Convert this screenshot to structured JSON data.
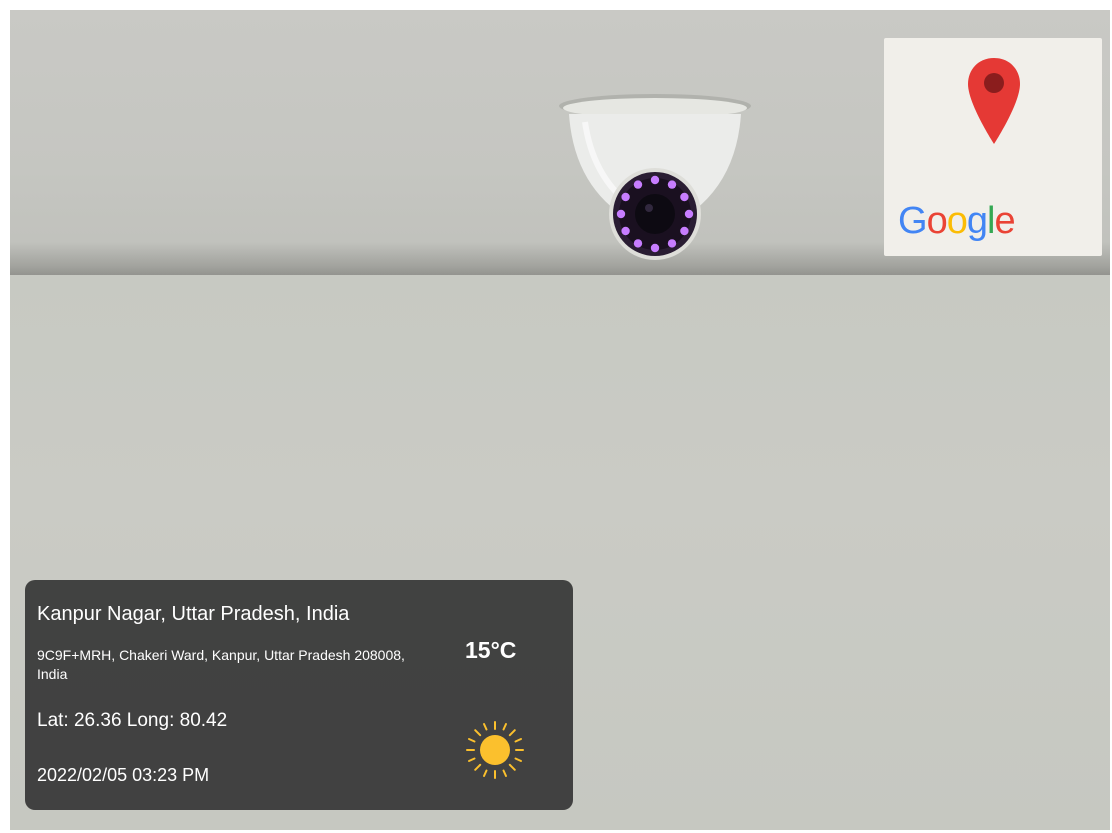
{
  "map_card": {
    "logo_text": "Google",
    "logo_letters": [
      {
        "char": "G",
        "color": "#4285F4"
      },
      {
        "char": "o",
        "color": "#EA4335"
      },
      {
        "char": "o",
        "color": "#FBBC05"
      },
      {
        "char": "g",
        "color": "#4285F4"
      },
      {
        "char": "l",
        "color": "#34A853"
      },
      {
        "char": "e",
        "color": "#EA4335"
      }
    ],
    "pin_icon": "map-pin-icon",
    "pin_color": "#E53935"
  },
  "info_panel": {
    "location_title": "Kanpur Nagar, Uttar Pradesh, India",
    "address": "9C9F+MRH, Chakeri Ward, Kanpur, Uttar Pradesh 208008, India",
    "lat_long": "Lat: 26.36 Long: 80.42",
    "datetime": "2022/02/05 03:23 PM",
    "temperature": "15°C",
    "weather_icon": "sun-icon",
    "weather_color": "#FBC02D"
  },
  "scene": {
    "subject": "camera-icon",
    "led_color": "#C77DFF"
  }
}
